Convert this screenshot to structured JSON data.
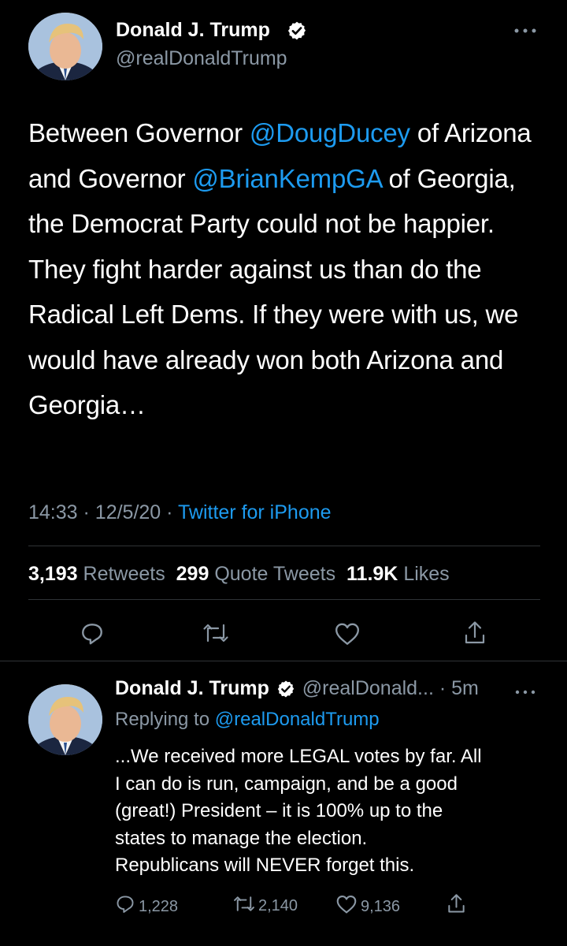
{
  "main_tweet": {
    "display_name": "Donald J. Trump",
    "handle": "@realDonaldTrump",
    "more_icon": "more-horizontal-icon",
    "text_parts": {
      "p1": "Between Governor ",
      "m1": "@DougDucey",
      "p2": " of Arizona and Governor ",
      "m2": "@BrianKempGA",
      "p3": " of Georgia, the Democrat Party could not be happier. They fight harder against us than do the Radical Left Dems. If they were with us, we would have already won both Arizona and Georgia…"
    },
    "time": "14:33",
    "date": "12/5/20",
    "separator": "·",
    "source": "Twitter for iPhone",
    "retweets_count": "3,193",
    "retweets_label": "Retweets",
    "quotes_count": "299",
    "quotes_label": "Quote Tweets",
    "likes_count": "11.9K",
    "likes_label": "Likes",
    "actions": [
      "reply-icon",
      "retweet-icon",
      "like-icon",
      "share-icon"
    ]
  },
  "reply_tweet": {
    "display_name": "Donald J. Trump",
    "handle": "@realDonald...",
    "age": "5m",
    "separator": "·",
    "replying_prefix": "Replying to",
    "replying_handle": "@realDonaldTrump",
    "text_lines": [
      "...We received more LEGAL votes by far. All",
      "I can do is run, campaign, and be a good",
      "(great!) President – it is 100% up to the",
      "states to manage the election.",
      "Republicans will NEVER forget this."
    ],
    "reply_count": "1,228",
    "retweet_count": "2,140",
    "like_count": "9,136"
  },
  "colors": {
    "background": "#000000",
    "text": "#ffffff",
    "secondary": "#8b98a5",
    "accent": "#1d9bf0",
    "divider": "#2f3336"
  }
}
